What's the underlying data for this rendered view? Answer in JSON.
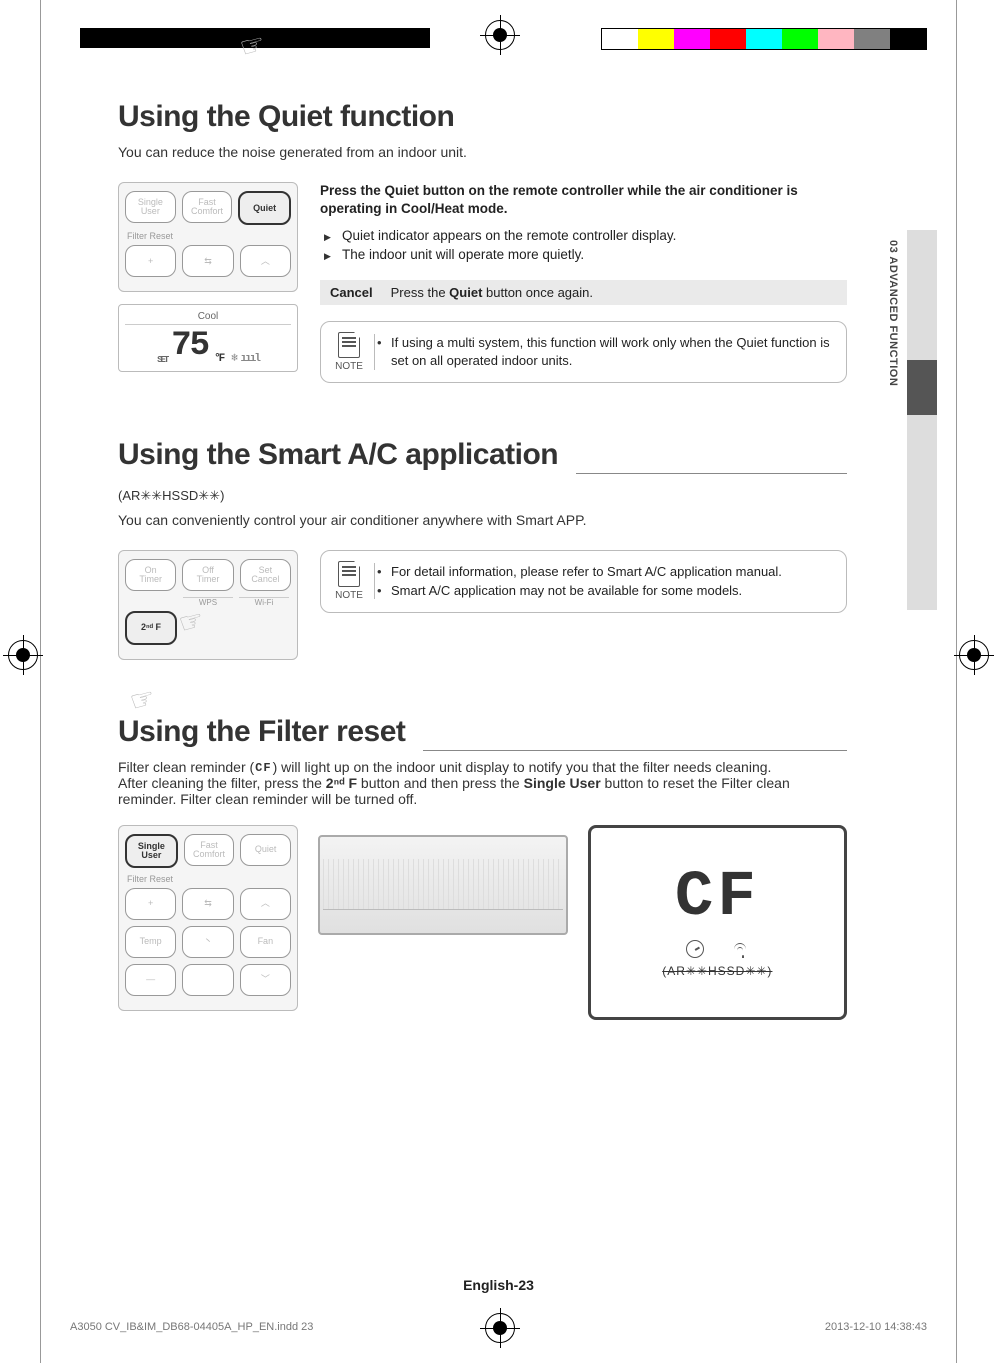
{
  "side_tab": {
    "label": "03  ADVANCED FUNCTION"
  },
  "quiet": {
    "heading": "Using the Quiet function",
    "intro": "You can reduce the noise generated from an indoor unit.",
    "remote": {
      "row1": [
        "Single\nUser",
        "Fast\nComfort",
        "Quiet"
      ],
      "filter_label": "Filter Reset",
      "row2": [
        "+",
        "⇆",
        "︿"
      ],
      "display": {
        "set": "SET",
        "mode": "Cool",
        "temp": "75",
        "unit": "°F",
        "fan_icon": "❄",
        "bars": "ıııl"
      }
    },
    "lead": "Press the Quiet button on the remote controller while the air conditioner is operating in Cool/Heat mode.",
    "bullets": [
      "Quiet indicator appears on the remote controller display.",
      "The indoor unit will operate more quietly."
    ],
    "cancel": {
      "label": "Cancel",
      "text_before": "Press the ",
      "text_bold": "Quiet",
      "text_after": " button once again."
    },
    "note": {
      "label": "NOTE",
      "items": [
        "If using a multi system, this function will work only when the Quiet function is set on all operated indoor units."
      ]
    }
  },
  "smart": {
    "heading": "Using the Smart A/C application",
    "model": "(AR✳✳HSSD✳✳)",
    "intro": "You can conveniently control your air conditioner anywhere with Smart APP.",
    "remote": {
      "row1": [
        "On\nTimer",
        "Off\nTimer",
        "Set\nCancel"
      ],
      "sub": [
        "WPS",
        "Wi-Fi"
      ],
      "row2": [
        "2ⁿᵈ F"
      ]
    },
    "note": {
      "label": "NOTE",
      "items": [
        "For detail information, please refer to Smart A/C application manual.",
        "Smart A/C application may not be available for some models."
      ]
    }
  },
  "filter": {
    "heading": "Using the Filter reset",
    "cf_inline": "CF",
    "text": {
      "p1_before": "Filter clean reminder (",
      "p1_after": ") will light up on the indoor unit display to notify you that the filter needs cleaning.",
      "p2_before": "After cleaning the filter, press the ",
      "p2_b1": "2ⁿᵈ F",
      "p2_mid": " button and then press the ",
      "p2_b2": "Single User",
      "p2_after": " button to reset the Filter clean reminder. Filter clean reminder will be turned off."
    },
    "remote": {
      "row1": [
        "Single\nUser",
        "Fast\nComfort",
        "Quiet"
      ],
      "filter_label": "Filter Reset",
      "row2": [
        "+",
        "⇆",
        "︿"
      ],
      "row3": [
        "Temp",
        "⼂",
        "Fan"
      ],
      "row4": [
        "—",
        "",
        "﹀"
      ]
    },
    "display": {
      "cf": "CF",
      "model": "(AR✳✳HSSD✳✳)"
    }
  },
  "footer": {
    "page": "English-23",
    "left": "A3050 CV_IB&IM_DB68-04405A_HP_EN.indd   23",
    "right": "2013-12-10   14:38:43"
  },
  "swatches": [
    "#ffffff",
    "#ffff00",
    "#ff00ff",
    "#ff0000",
    "#00ffff",
    "#00ff00",
    "#ffb6c1",
    "#808080",
    "#000000"
  ]
}
